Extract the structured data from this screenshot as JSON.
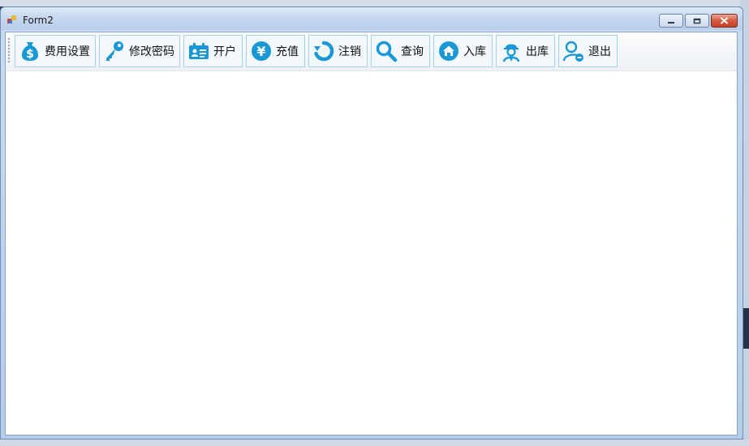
{
  "window": {
    "title": "Form2"
  },
  "colors": {
    "icon_blue": "#1a98d5",
    "button_border": "#9fd4ec",
    "close_red": "#c8412a"
  },
  "toolbar": {
    "buttons": [
      {
        "id": "fee-settings",
        "label": "费用设置",
        "icon": "money-bag-icon"
      },
      {
        "id": "change-password",
        "label": "修改密码",
        "icon": "key-icon"
      },
      {
        "id": "open-account",
        "label": "开户",
        "icon": "id-card-icon"
      },
      {
        "id": "recharge",
        "label": "充值",
        "icon": "yen-icon"
      },
      {
        "id": "cancel-account",
        "label": "注销",
        "icon": "refresh-icon"
      },
      {
        "id": "query",
        "label": "查询",
        "icon": "search-icon"
      },
      {
        "id": "check-in",
        "label": "入库",
        "icon": "home-icon"
      },
      {
        "id": "check-out",
        "label": "出库",
        "icon": "worker-icon"
      },
      {
        "id": "exit",
        "label": "退出",
        "icon": "user-logout-icon"
      }
    ]
  }
}
